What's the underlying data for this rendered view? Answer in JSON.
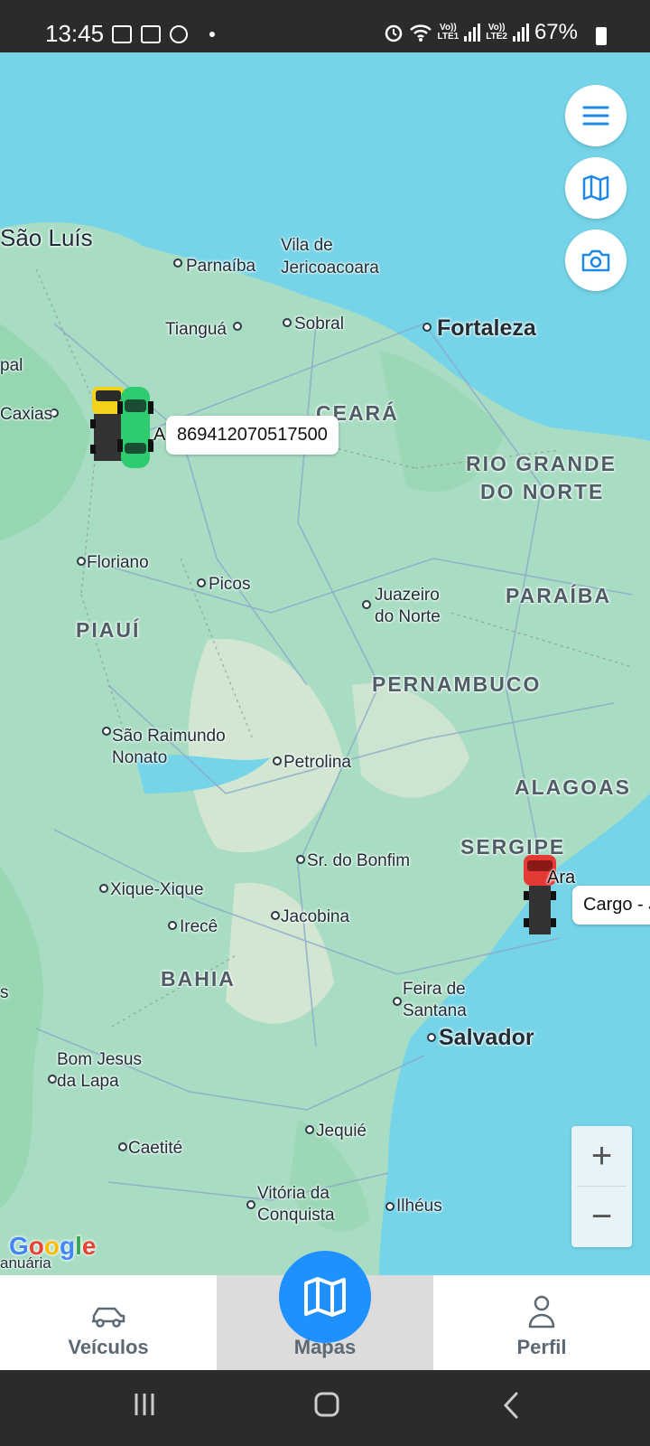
{
  "status_bar": {
    "time": "13:45",
    "battery": "67%",
    "icons": [
      "gallery-icon",
      "voicemail-icon",
      "do-not-disturb-icon",
      "dot-icon",
      "alarm-icon",
      "wifi-icon",
      "volte-lte1-signal-icon",
      "volte-lte2-signal-icon",
      "battery-icon"
    ],
    "lte1": "LTE1",
    "lte2": "LTE2",
    "volte": "Vo))"
  },
  "map": {
    "water_color": "#76d4e8",
    "land_color": "#a9ddc3",
    "forest_color": "#8fd3a9",
    "cities": {
      "sao_luis": "São Luís",
      "parnaiba": "Parnaíba",
      "vila_de": "Vila de",
      "jericoacoara": "Jericoacoara",
      "tiangua": "Tianguá",
      "sobral": "Sobral",
      "fortaleza": "Fortaleza",
      "pal": "pal",
      "caxias": "Caxias",
      "floriano": "Floriano",
      "picos": "Picos",
      "juazeiro_1": "Juazeiro",
      "juazeiro_2": "do Norte",
      "sao_raimundo_1": "São Raimundo",
      "sao_raimundo_2": "Nonato",
      "petrolina": "Petrolina",
      "sr_do_bonfim": "Sr. do Bonfim",
      "xique_xique": "Xique-Xique",
      "irece": "Irecê",
      "jacobina": "Jacobina",
      "feira_1": "Feira de",
      "feira_2": "Santana",
      "salvador": "Salvador",
      "bom_jesus_1": "Bom Jesus",
      "bom_jesus_2": "da Lapa",
      "caetite": "Caetité",
      "jequie": "Jequié",
      "vitoria_1": "Vitória da",
      "vitoria_2": "Conquista",
      "ilheus": "Ilhéus",
      "s_left": "s",
      "januaria": "anuária"
    },
    "states": {
      "ceara": "CEARÁ",
      "rgn_1": "RIO GRANDE",
      "rgn_2": "DO NORTE",
      "paraiba": "PARAÍBA",
      "piaui": "PIAUÍ",
      "pernambuco": "PERNAMBUCO",
      "alagoas": "ALAGOAS",
      "sergipe": "SERGIPE",
      "bahia": "BAHIA"
    },
    "vehicles": [
      {
        "label_prefix": "A",
        "callout": "869412070517500"
      },
      {
        "label_prefix": "Ara",
        "callout": "Cargo - J"
      }
    ],
    "zoom_in": "+",
    "zoom_out": "−",
    "attribution": "Google"
  },
  "fabs": [
    "menu-icon",
    "map-icon",
    "camera-icon"
  ],
  "bottom_nav": {
    "vehicles": "Veículos",
    "maps": "Mapas",
    "profile": "Perfil"
  }
}
